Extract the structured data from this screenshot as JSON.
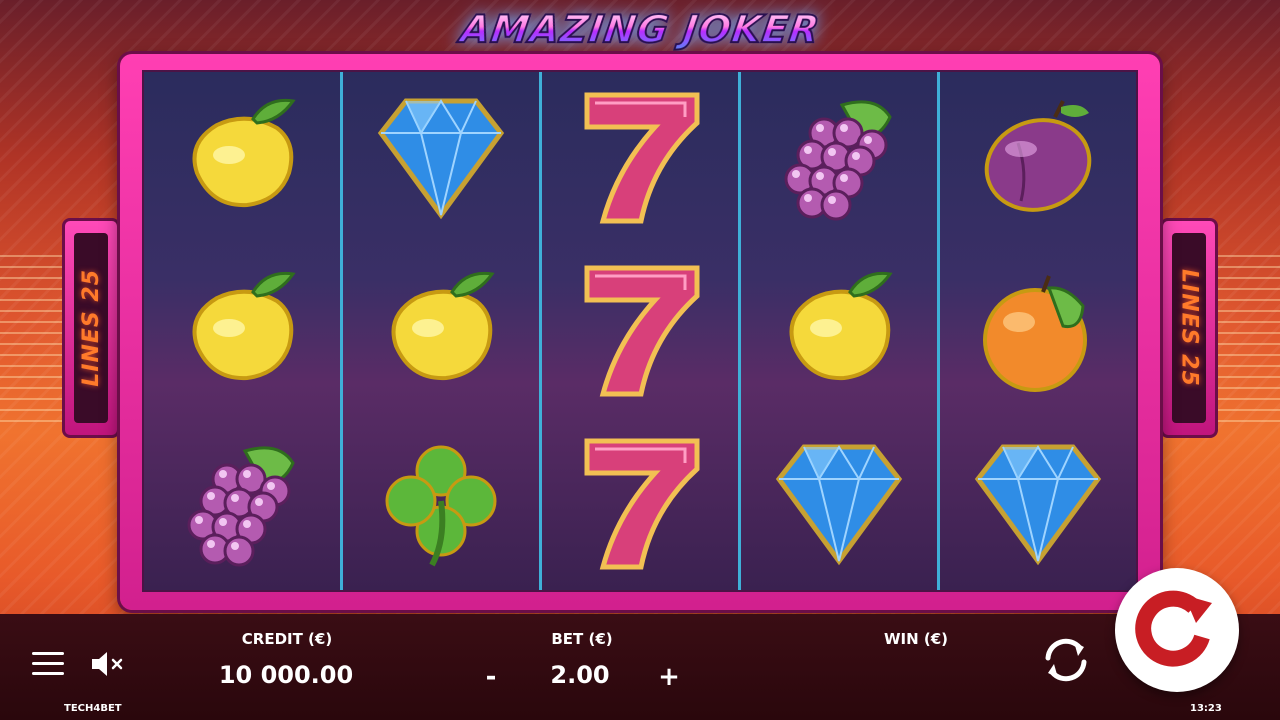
{
  "game": {
    "title": "AMAZING JOKER",
    "lines_label_left": "LINES 25",
    "lines_label_right": "LINES 25"
  },
  "reels": [
    [
      "lemon",
      "lemon",
      "grapes"
    ],
    [
      "diamond",
      "lemon",
      "clover"
    ],
    [
      "seven",
      "seven",
      "seven"
    ],
    [
      "grapes",
      "lemon",
      "diamond"
    ],
    [
      "plum",
      "orange",
      "diamond"
    ]
  ],
  "controls": {
    "credit_label": "CREDIT (€)",
    "credit_value": "10 000.00",
    "bet_label": "BET (€)",
    "bet_value": "2.00",
    "bet_minus": "-",
    "bet_plus": "+",
    "win_label": "WIN (€)",
    "win_value": ""
  },
  "footer": {
    "brand": "TECH4BET",
    "time": "13:23"
  },
  "icons": {
    "menu": "hamburger-menu-icon",
    "sound": "speaker-muted-icon",
    "autoplay": "refresh-arrows-icon",
    "spin": "circular-arrow-icon"
  },
  "colors": {
    "frame": "#ff3fb3",
    "reel_separator": "#3fb0d8",
    "bottom_bar": "#2a070c"
  }
}
